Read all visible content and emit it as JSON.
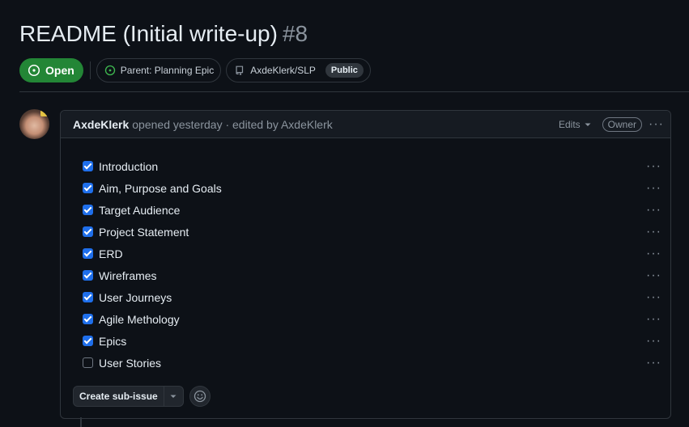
{
  "issue": {
    "title": "README (Initial write-up)",
    "number": "#8",
    "state": "Open",
    "parent_label": "Parent: Planning Epic",
    "repo": "AxdeKlerk/SLP",
    "visibility": "Public"
  },
  "comment": {
    "author": "AxdeKlerk",
    "meta": "opened yesterday · edited by AxdeKlerk",
    "edits_label": "Edits",
    "owner_badge": "Owner",
    "menu_glyph": "···"
  },
  "tasks": [
    {
      "label": "Introduction",
      "checked": true
    },
    {
      "label": "Aim, Purpose and Goals",
      "checked": true
    },
    {
      "label": "Target Audience",
      "checked": true
    },
    {
      "label": "Project Statement",
      "checked": true
    },
    {
      "label": "ERD",
      "checked": true
    },
    {
      "label": "Wireframes",
      "checked": true
    },
    {
      "label": "User Journeys",
      "checked": true
    },
    {
      "label": "Agile Methology",
      "checked": true
    },
    {
      "label": "Epics",
      "checked": true
    },
    {
      "label": "User Stories",
      "checked": false
    }
  ],
  "footer": {
    "create_sub_issue_label": "Create sub-issue"
  },
  "colors": {
    "background": "#0d1117",
    "open_green": "#238636",
    "checkbox_blue": "#1f6feb",
    "border": "#30363d",
    "muted_text": "#8b949e"
  },
  "icons": [
    "issue-opened-icon",
    "repo-icon",
    "triangle-down-icon",
    "kebab-horizontal-icon",
    "checkbox-checked-icon",
    "smiley-icon"
  ]
}
